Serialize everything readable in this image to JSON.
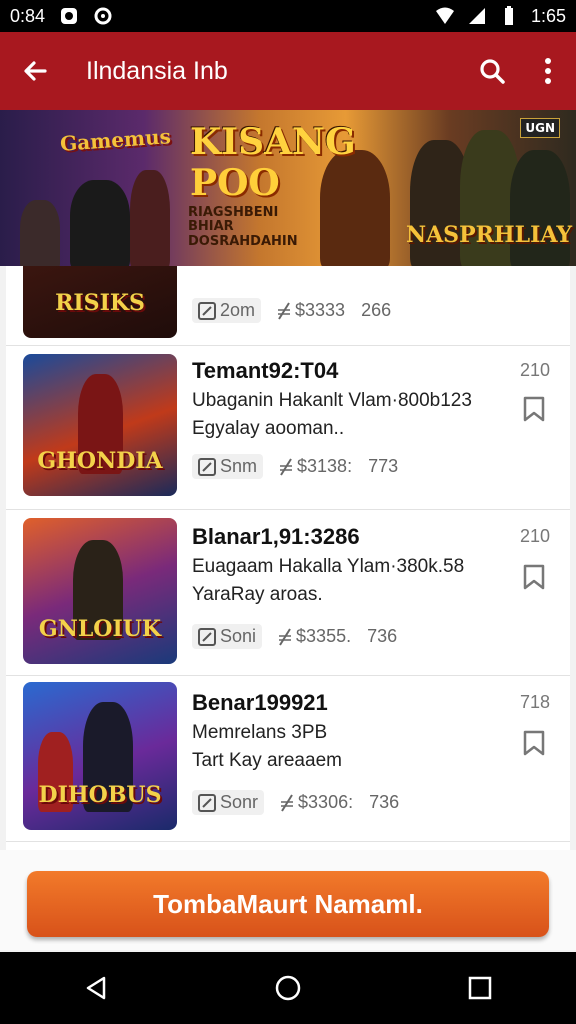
{
  "status_bar": {
    "time_left": "0:84",
    "time_right": "1:65"
  },
  "app_bar": {
    "title": "Ilndansia Inb"
  },
  "banner": {
    "logo_left": "Gamemus",
    "headline": "KISANG",
    "headline2": "POO",
    "subline": "RIAGSHBENI BHIAR DOSRAHDAHIN",
    "logo_right": "NASPRHLIAY",
    "badge": "UGN"
  },
  "items": [
    {
      "title": "",
      "desc1": "",
      "desc2": "",
      "chip": "2om",
      "price": "$3333",
      "count_meta": "266",
      "count": "",
      "thumb_label": "RISIKS"
    },
    {
      "title": "Temant92:T04",
      "desc1": "Ubaganin Hakanlt Vlam·800b123",
      "desc2": "Egyalay aooman..",
      "chip": "Snm",
      "price": "$3138:",
      "count_meta": "773",
      "count": "210",
      "thumb_label": "GHONDIA"
    },
    {
      "title": "Blanar1,91:3286",
      "desc1": "Euagaam Hakalla Ylam·380k.58",
      "desc2": "YaraRay aroas.",
      "chip": "Soni",
      "price": "$3355.",
      "count_meta": "736",
      "count": "210",
      "thumb_label": "GNLOIUK"
    },
    {
      "title": "Benar199921",
      "desc1": "Memrelans 3PB",
      "desc2": "Tart Kay areaaem",
      "chip": "Sonr",
      "price": "$3306:",
      "count_meta": "736",
      "count": "718",
      "thumb_label": "DIHOBUS"
    }
  ],
  "cta": {
    "label": "TombaMaurt Namaml."
  },
  "colors": {
    "app_bar": "#a8181f",
    "cta": "#e0601f",
    "status_bar": "#000000"
  },
  "icons": [
    "back-arrow-icon",
    "search-icon",
    "more-vert-icon",
    "bookmark-icon",
    "edit-icon",
    "price-tag-icon",
    "nav-back-icon",
    "nav-home-icon",
    "nav-recents-icon"
  ]
}
